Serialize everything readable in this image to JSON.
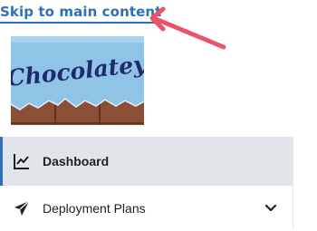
{
  "skip_link": {
    "label": "Skip to main content"
  },
  "logo": {
    "text": "Chocolatey",
    "colors": {
      "sky": "#8fc4e6",
      "wordmark": "#1d2b6b",
      "chocolate": "#8a4f35"
    }
  },
  "annotation": {
    "kind": "arrow",
    "color": "#e9546b"
  },
  "nav": {
    "items": [
      {
        "label": "Dashboard",
        "icon": "line-chart-icon",
        "active": true
      },
      {
        "label": "Deployment Plans",
        "icon": "paper-plane-icon",
        "active": false,
        "expandable": true
      }
    ]
  },
  "colors": {
    "accent": "#2e70b7",
    "active_bg": "#e1e4e8"
  }
}
